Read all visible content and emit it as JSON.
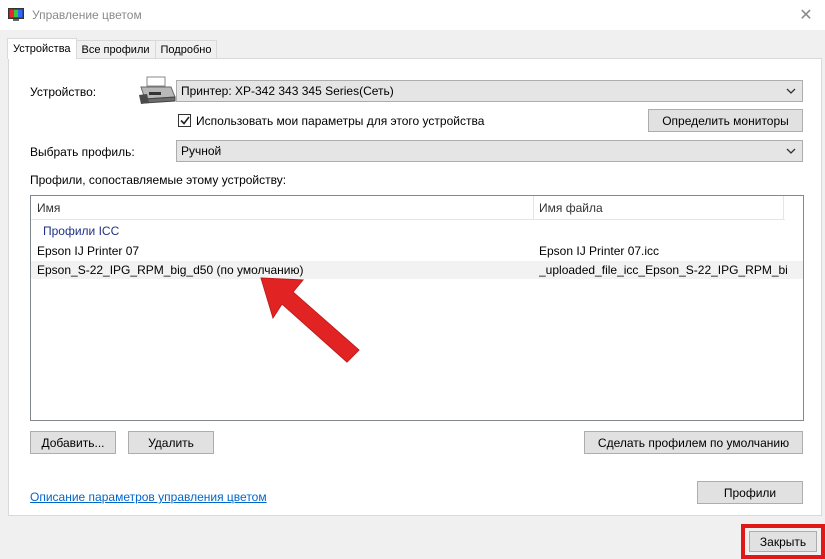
{
  "window": {
    "title": "Управление цветом",
    "close_glyph": "✕"
  },
  "tabs": [
    {
      "label": "Устройства",
      "active": true
    },
    {
      "label": "Все профили",
      "active": false
    },
    {
      "label": "Подробно",
      "active": false
    }
  ],
  "device": {
    "label": "Устройство:",
    "selected": "Принтер: XP-342 343 345 Series(Сеть)",
    "checkbox_label": "Использовать мои параметры для этого устройства",
    "checkbox_checked": true,
    "identify_button": "Определить мониторы"
  },
  "profile_select": {
    "label": "Выбрать профиль:",
    "selected": "Ручной"
  },
  "profiles_list": {
    "caption": "Профили, сопоставляемые этому устройству:",
    "columns": [
      "Имя",
      "Имя файла"
    ],
    "group": "Профили ICC",
    "rows": [
      {
        "name": "Epson IJ Printer 07",
        "file": "Epson IJ Printer 07.icc",
        "selected": false
      },
      {
        "name": "Epson_S-22_IPG_RPM_big_d50 (по умолчанию)",
        "file": "_uploaded_file_icc_Epson_S-22_IPG_RPM_bi...",
        "selected": true
      }
    ]
  },
  "buttons": {
    "add": "Добавить...",
    "remove": "Удалить",
    "set_default": "Сделать профилем по умолчанию",
    "profiles": "Профили",
    "close": "Закрыть"
  },
  "link": "Описание параметров управления цветом",
  "colors": {
    "highlight_red": "#e01818",
    "link_blue": "#0066cc",
    "group_blue": "#1e3287"
  }
}
